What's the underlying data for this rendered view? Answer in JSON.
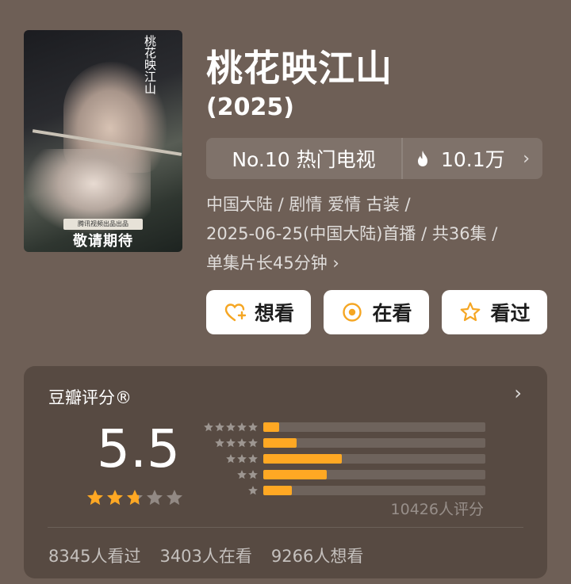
{
  "poster": {
    "logo_text": "桃花映江山",
    "banner_text": "腾讯视频出品出品",
    "tagline": "敬请期待"
  },
  "title": "桃花映江山",
  "year": "(2025)",
  "rank": {
    "label": "No.10 热门电视",
    "heat": "10.1万",
    "flame_icon": "flame-icon",
    "chevron": "›"
  },
  "meta": {
    "line1": "中国大陆 / 剧情 爱情 古装 /",
    "line2": "2025-06-25(中国大陆)首播 / 共36集 /",
    "line3": "单集片长45分钟 ›"
  },
  "actions": {
    "want": "想看",
    "watching": "在看",
    "watched": "看过"
  },
  "rating": {
    "title": "豆瓣评分®",
    "score": "5.5",
    "score_stars": 2.75,
    "distribution": [
      {
        "stars": 5,
        "fraction": 0.07
      },
      {
        "stars": 4,
        "fraction": 0.15
      },
      {
        "stars": 3,
        "fraction": 0.355
      },
      {
        "stars": 2,
        "fraction": 0.285
      },
      {
        "stars": 1,
        "fraction": 0.13
      }
    ],
    "count_text": "10426人评分",
    "chevron": "›"
  },
  "stats": {
    "watched": "8345人看过",
    "watching": "3403人在看",
    "want": "9266人想看"
  },
  "colors": {
    "background": "#6e5f56",
    "accent_orange": "#ffa823",
    "button_bg": "#ffffff"
  }
}
